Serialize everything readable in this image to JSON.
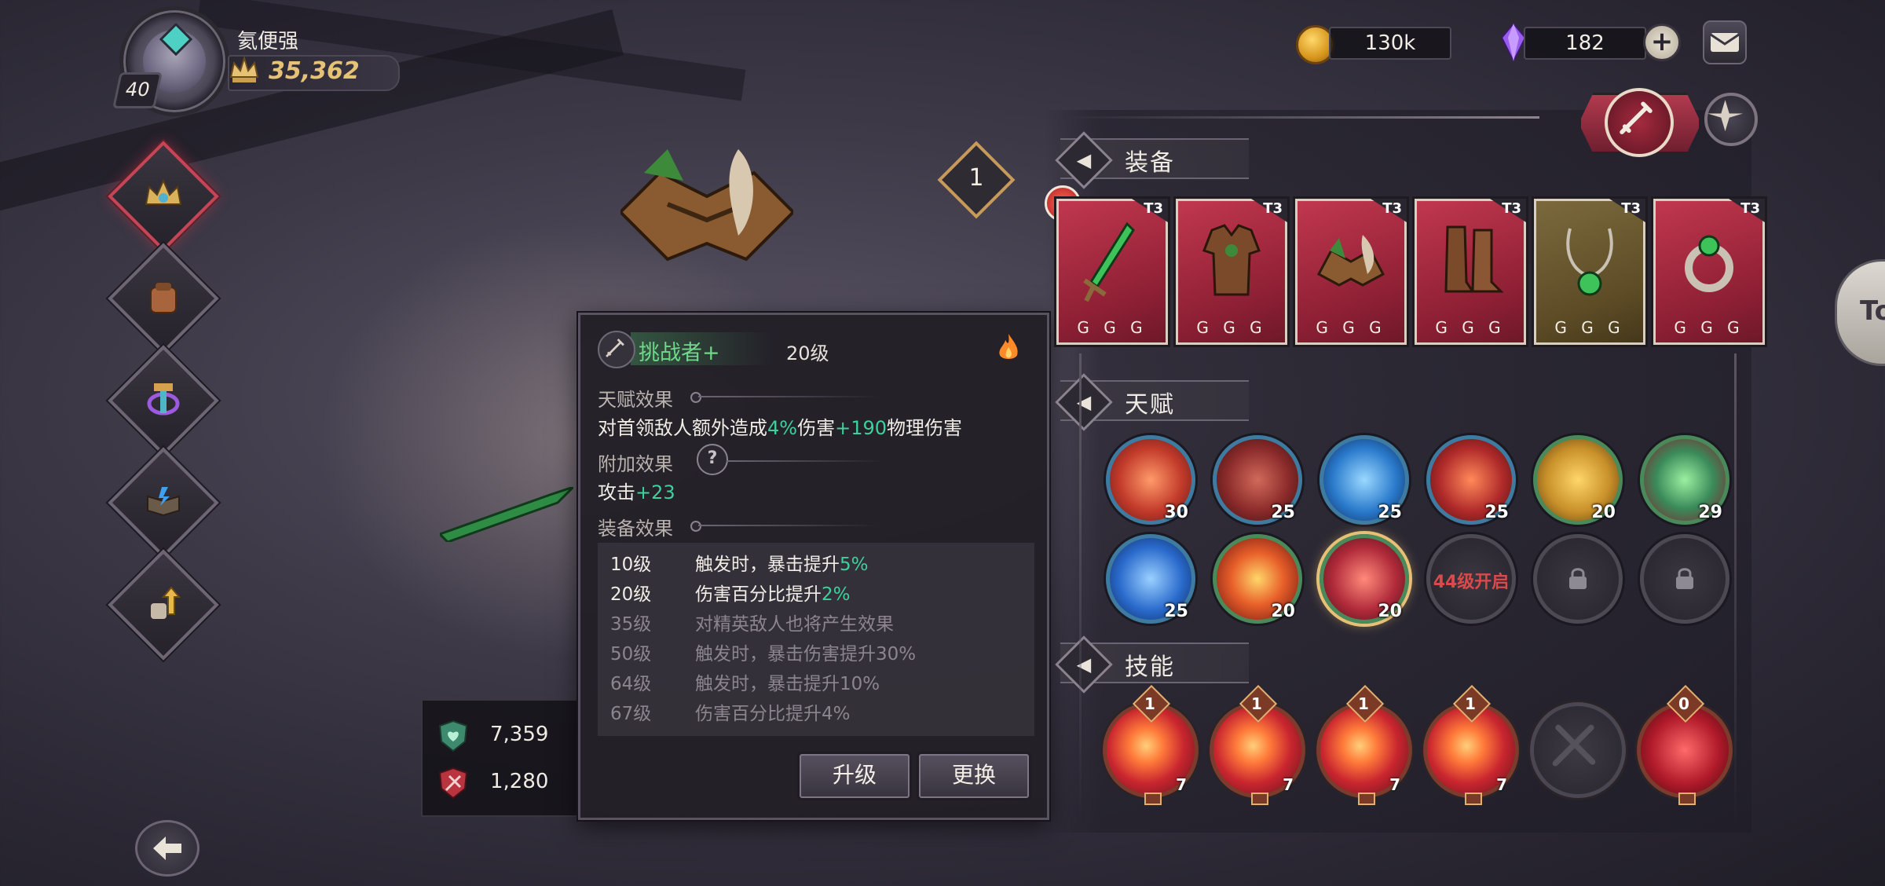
{
  "player": {
    "name": "氦便强",
    "level": "40",
    "power": "35,362"
  },
  "resources": {
    "gold": "130k",
    "gems": "182"
  },
  "hero_badge": "1",
  "sections": {
    "equipment": "装备",
    "talent": "天赋",
    "skill": "技能"
  },
  "equipment": [
    {
      "name": "sword-item",
      "tier": "T3",
      "pips": "G G G",
      "color": "red"
    },
    {
      "name": "armor-item",
      "tier": "T3",
      "pips": "G G G",
      "color": "red"
    },
    {
      "name": "hat-item",
      "tier": "T3",
      "pips": "G G G",
      "color": "red"
    },
    {
      "name": "boots-item",
      "tier": "T3",
      "pips": "G G G",
      "color": "red"
    },
    {
      "name": "necklace-item",
      "tier": "T3",
      "pips": "G G G",
      "color": "gold"
    },
    {
      "name": "ring-item",
      "tier": "T3",
      "pips": "G G G",
      "color": "red"
    }
  ],
  "talents_row1": [
    "30",
    "25",
    "25",
    "25",
    "20",
    "29"
  ],
  "talents_row2": [
    "25",
    "20",
    "20"
  ],
  "talent_unlock_text": "44级开启",
  "skills": [
    {
      "top": "1",
      "num": "7"
    },
    {
      "top": "1",
      "num": "7"
    },
    {
      "top": "1",
      "num": "7"
    },
    {
      "top": "1",
      "num": "7"
    },
    {
      "top": "",
      "num": ""
    },
    {
      "top": "0",
      "num": ""
    }
  ],
  "stats": {
    "hp": "7,359",
    "attack": "1,280"
  },
  "tooltip": {
    "name": "挑战者+",
    "level": "20级",
    "talent_title": "天赋效果",
    "talent_desc_a": "对首领敌人额外造成",
    "talent_desc_b": "4%",
    "talent_desc_c": "伤害",
    "talent_desc_d": "+190",
    "talent_desc_e": "物理伤害",
    "bonus_title": "附加效果",
    "bonus_a": "攻击",
    "bonus_b": "+23",
    "equip_title": "装备效果",
    "rows": [
      {
        "level": "10级",
        "desc_a": "触发时，暴击提升",
        "desc_b": "5%",
        "active": true
      },
      {
        "level": "20级",
        "desc_a": "伤害百分比提升",
        "desc_b": "2%",
        "active": true
      },
      {
        "level": "35级",
        "desc_a": "对精英敌人也将产生效果",
        "desc_b": "",
        "active": false
      },
      {
        "level": "50级",
        "desc_a": "触发时，暴击伤害提升30%",
        "desc_b": "",
        "active": false
      },
      {
        "level": "64级",
        "desc_a": "触发时，暴击提升10%",
        "desc_b": "",
        "active": false
      },
      {
        "level": "67级",
        "desc_a": "伤害百分比提升4%",
        "desc_b": "",
        "active": false
      }
    ],
    "upgrade_label": "升级",
    "replace_label": "更换"
  },
  "edge_text": "To"
}
